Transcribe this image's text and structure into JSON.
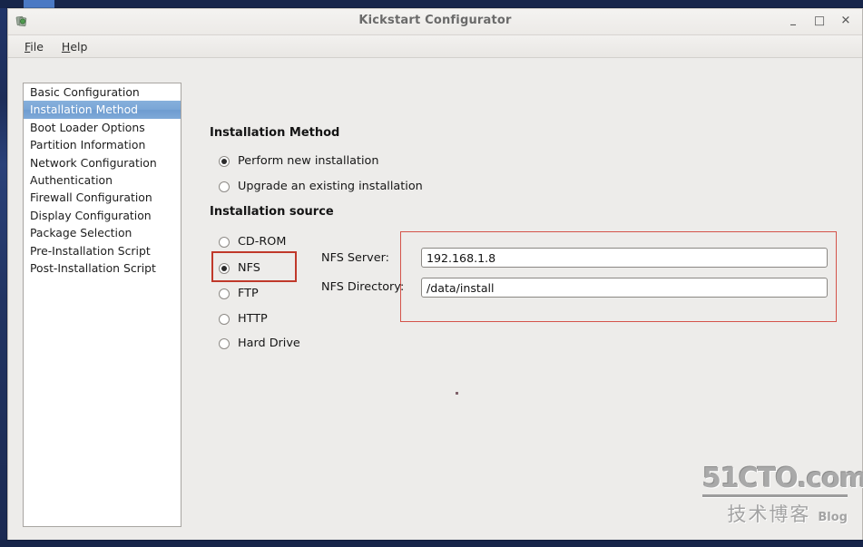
{
  "window": {
    "title": "Kickstart Configurator",
    "icon_name": "kickstart-app-icon",
    "controls": {
      "minimize": "–",
      "maximize": "□",
      "close": "✕"
    }
  },
  "menubar": {
    "items": [
      {
        "mnemonic": "F",
        "rest": "ile"
      },
      {
        "mnemonic": "H",
        "rest": "elp"
      }
    ]
  },
  "sidebar": {
    "items": [
      {
        "label": "Basic Configuration",
        "selected": false
      },
      {
        "label": "Installation Method",
        "selected": true
      },
      {
        "label": "Boot Loader Options",
        "selected": false
      },
      {
        "label": "Partition Information",
        "selected": false
      },
      {
        "label": "Network Configuration",
        "selected": false
      },
      {
        "label": "Authentication",
        "selected": false
      },
      {
        "label": "Firewall Configuration",
        "selected": false
      },
      {
        "label": "Display Configuration",
        "selected": false
      },
      {
        "label": "Package Selection",
        "selected": false
      },
      {
        "label": "Pre-Installation Script",
        "selected": false
      },
      {
        "label": "Post-Installation Script",
        "selected": false
      }
    ]
  },
  "main": {
    "method_section": {
      "title": "Installation Method",
      "options": [
        {
          "label": "Perform new installation",
          "checked": true
        },
        {
          "label": "Upgrade an existing installation",
          "checked": false
        }
      ]
    },
    "source_section": {
      "title": "Installation source",
      "options": [
        {
          "label": "CD-ROM",
          "checked": false
        },
        {
          "label": "NFS",
          "checked": true
        },
        {
          "label": "FTP",
          "checked": false
        },
        {
          "label": "HTTP",
          "checked": false
        },
        {
          "label": "Hard Drive",
          "checked": false
        }
      ]
    },
    "nfs_fields": {
      "server_label": "NFS Server:",
      "server_value": "192.168.1.8",
      "server_placeholder": "",
      "directory_label": "NFS Directory:",
      "directory_value": "/data/install",
      "directory_placeholder": ""
    },
    "annotations": {
      "nfs_radio_highlight_color": "#c0392b",
      "nfs_fields_highlight_color": "#d4534a"
    }
  },
  "watermark": {
    "site": "51CTO.com",
    "chinese": "技术博客",
    "blog": "Blog"
  },
  "theme": {
    "window_bg": "#efeeec",
    "content_bg": "#edecea",
    "selection_blue": "#7aa6d6",
    "desktop_blue": "#1b2a52"
  }
}
